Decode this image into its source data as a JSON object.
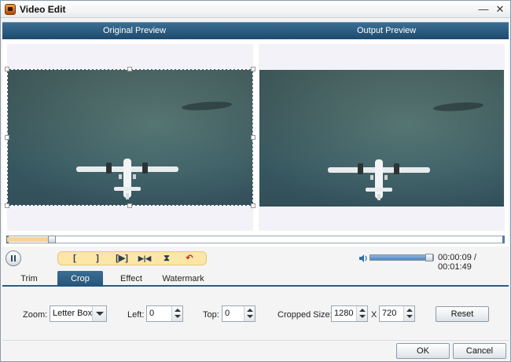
{
  "window": {
    "title": "Video Edit",
    "minimize_glyph": "—",
    "close_glyph": "✕"
  },
  "preview": {
    "original_label": "Original Preview",
    "output_label": "Output Preview"
  },
  "playback": {
    "progress_fraction": 0.09,
    "volume_fraction": 0.9,
    "time_text": "00:00:09 / 00:01:49"
  },
  "toolbar": {
    "tools": [
      {
        "name": "set-start",
        "glyph": "["
      },
      {
        "name": "set-end",
        "glyph": "]"
      },
      {
        "name": "play-segment",
        "glyph": "[▶]"
      },
      {
        "name": "split",
        "glyph": "▶|◀"
      },
      {
        "name": "merge",
        "glyph": "⧗"
      },
      {
        "name": "undo",
        "glyph": "↶"
      }
    ]
  },
  "tabs": [
    {
      "label": "Trim",
      "active": false
    },
    {
      "label": "Crop",
      "active": true
    },
    {
      "label": "Effect",
      "active": false
    },
    {
      "label": "Watermark",
      "active": false
    }
  ],
  "crop": {
    "zoom_label": "Zoom:",
    "zoom_value": "Letter Box",
    "left_label": "Left:",
    "left_value": "0",
    "top_label": "Top:",
    "top_value": "0",
    "size_label": "Cropped Size:",
    "width_value": "1280",
    "x_label": "X",
    "height_value": "720",
    "reset_label": "Reset"
  },
  "footer": {
    "ok_label": "OK",
    "cancel_label": "Cancel"
  },
  "colors": {
    "header_blue": "#1d4a6d",
    "active_tab": "#245479",
    "tool_strip": "#fbe6a8"
  }
}
